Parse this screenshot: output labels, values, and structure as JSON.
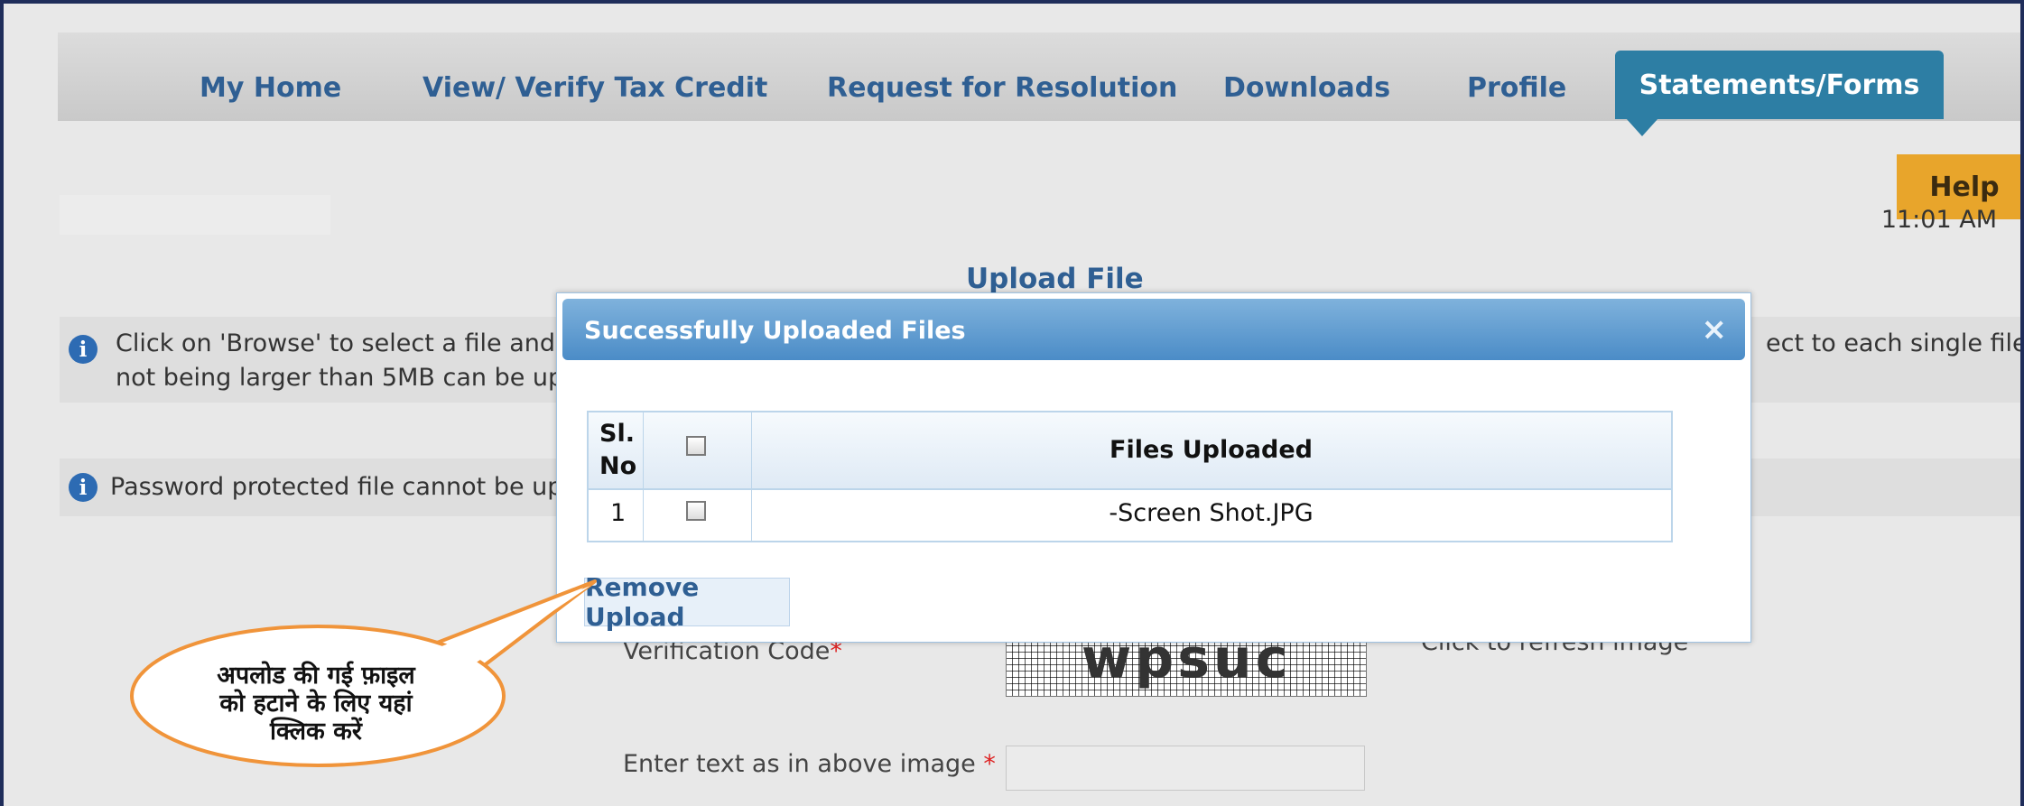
{
  "nav": {
    "items": [
      "My Home",
      "View/ Verify Tax Credit",
      "Request for Resolution",
      "Downloads",
      "Profile"
    ],
    "active": "Statements/Forms"
  },
  "help_label": "Help",
  "time_text": "11:01 AM",
  "page": {
    "upload_title": "Upload File",
    "info1_line1": "Click on 'Browse' to select a file and th",
    "info1_line1_right": "ect to each single file",
    "info1_line2": "not being larger than 5MB can be uploa",
    "info2": "Password protected file cannot be uplo",
    "verification_label": "Verification Code",
    "verification_required": "*",
    "refresh_label": "Click to refresh image",
    "captcha_text": "wpsuc",
    "enter_text_label": "Enter text as in above image",
    "enter_text_required": "*"
  },
  "modal": {
    "title": "Successfully Uploaded Files",
    "close": "×",
    "table": {
      "col_sl": "Sl. No",
      "col_sl_line1": "Sl.",
      "col_sl_line2": "No",
      "col_files": "Files Uploaded",
      "rows": [
        {
          "sl": "1",
          "file": "-Screen Shot.JPG"
        }
      ]
    },
    "remove_button": "Remove Upload"
  },
  "callout": {
    "text_line1": "अपलोड की गई फ़ाइल",
    "text_line2": "को हटाने के लिए यहां",
    "text_line3": "क्लिक करें"
  },
  "colors": {
    "nav_text": "#2f5f93",
    "active_tab": "#2d7ea4",
    "help": "#e8a52b",
    "callout_border": "#f0943a",
    "frame_border": "#1f2d5a"
  }
}
